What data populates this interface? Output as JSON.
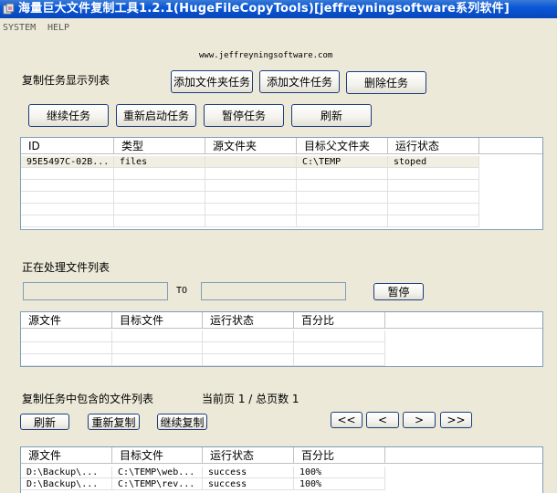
{
  "window": {
    "title": "海量巨大文件复制工具1.2.1(HugeFileCopyTools)[jeffreyningsoftware系列软件]"
  },
  "menu": {
    "system": "SYSTEM",
    "help": "HELP"
  },
  "site": "www.jeffreyningsoftware.com",
  "tasks": {
    "label": "复制任务显示列表",
    "buttons": {
      "add_folder_task": "添加文件夹任务",
      "add_file_task": "添加文件任务",
      "delete_task": "删除任务",
      "continue_task": "继续任务",
      "restart_task": "重新启动任务",
      "pause_task": "暂停任务",
      "refresh": "刷新"
    },
    "columns": [
      "ID",
      "类型",
      "源文件夹",
      "目标父文件夹",
      "运行状态"
    ],
    "rows": [
      [
        "95E5497C-02B...",
        "files",
        "",
        "C:\\TEMP",
        "stoped"
      ]
    ]
  },
  "processing": {
    "label": "正在处理文件列表",
    "to_label": "TO",
    "source_value": "",
    "target_value": "",
    "pause": "暂停",
    "columns": [
      "源文件",
      "目标文件",
      "运行状态",
      "百分比"
    ],
    "rows": []
  },
  "files": {
    "label": "复制任务中包含的文件列表",
    "page_info": "当前页 1 / 总页数 1",
    "buttons": {
      "refresh": "刷新",
      "recopy": "重新复制",
      "continue_copy": "继续复制",
      "first": "<<",
      "prev": "<",
      "next": ">",
      "last": ">>"
    },
    "columns": [
      "源文件",
      "目标文件",
      "运行状态",
      "百分比"
    ],
    "rows": [
      [
        "D:\\Backup\\...",
        "C:\\TEMP\\web...",
        "success",
        "100%"
      ],
      [
        "D:\\Backup\\...",
        "C:\\TEMP\\rev...",
        "success",
        "100%"
      ]
    ]
  },
  "icons": {
    "app": "copy-app-icon"
  },
  "colors": {
    "titlebar": "#0a58d8",
    "window_bg": "#ece9d8",
    "grid_border": "#7f9db9"
  }
}
